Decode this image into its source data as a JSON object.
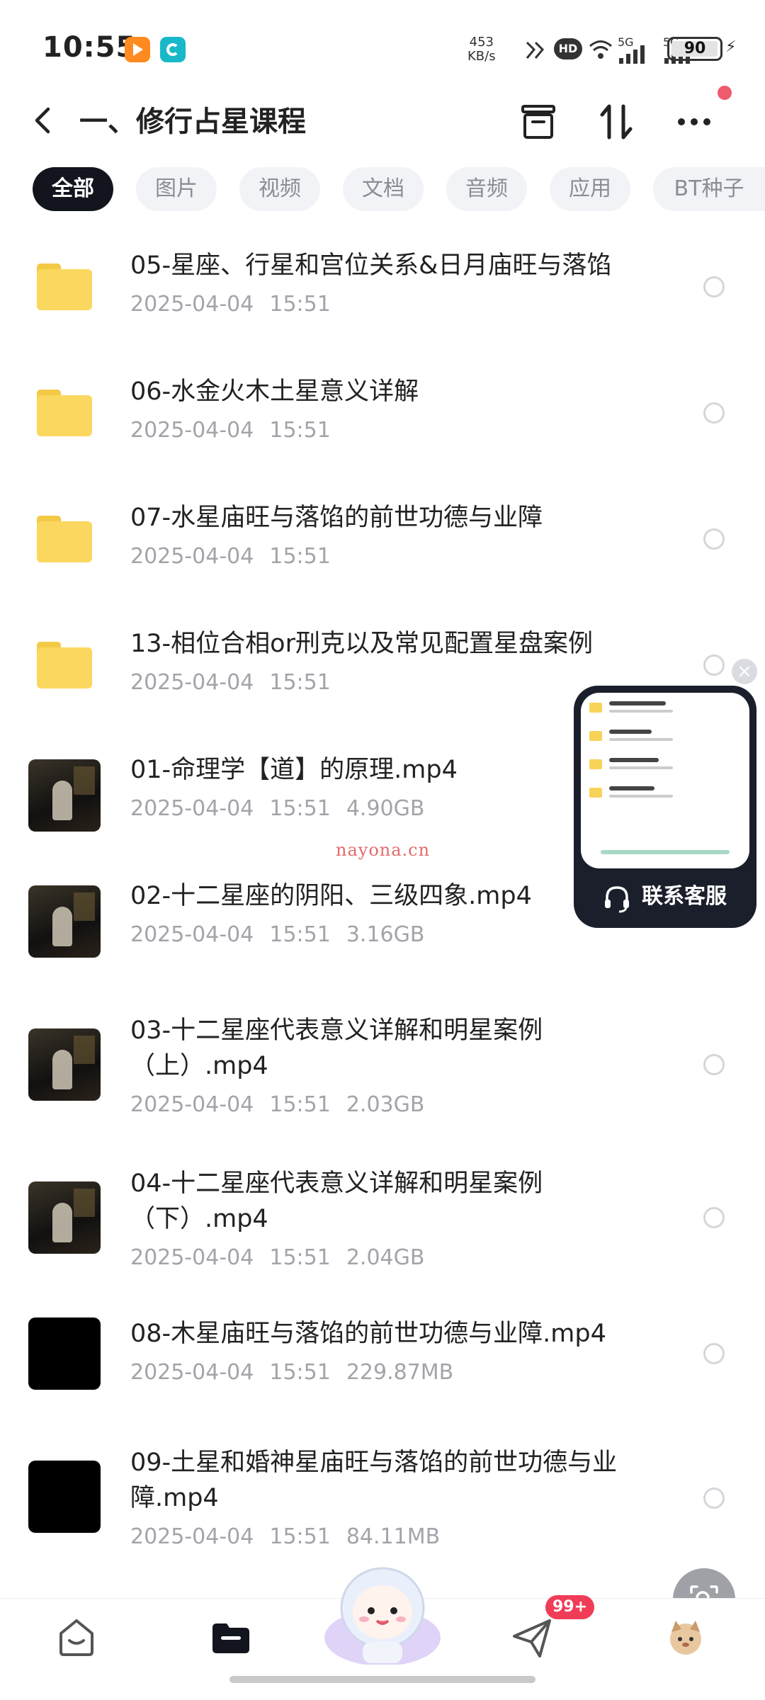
{
  "status_bar": {
    "time": "10:55",
    "net_speed_value": "453",
    "net_speed_unit": "KB/s",
    "network_1": "5G",
    "network_2": "5G",
    "battery": "90"
  },
  "header": {
    "title": "一、修行占星课程",
    "icons": [
      "back-icon",
      "archive-icon",
      "sort-icon",
      "more-icon"
    ]
  },
  "tabs": [
    "全部",
    "图片",
    "视频",
    "文档",
    "音频",
    "应用",
    "BT种子"
  ],
  "files": [
    {
      "name": "05-星座、行星和宫位关系&日月庙旺与落馅",
      "date": "2025-04-04",
      "time": "15:51",
      "size": "",
      "type": "folder"
    },
    {
      "name": "06-水金火木土星意义详解",
      "date": "2025-04-04",
      "time": "15:51",
      "size": "",
      "type": "folder"
    },
    {
      "name": "07-水星庙旺与落馅的前世功德与业障",
      "date": "2025-04-04",
      "time": "15:51",
      "size": "",
      "type": "folder"
    },
    {
      "name": "13-相位合相or刑克以及常见配置星盘案例",
      "date": "2025-04-04",
      "time": "15:51",
      "size": "",
      "type": "folder"
    },
    {
      "name": "01-命理学【道】的原理.mp4",
      "date": "2025-04-04",
      "time": "15:51",
      "size": "4.90GB",
      "type": "video"
    },
    {
      "name": "02-十二星座的阴阳、三级四象.mp4",
      "date": "2025-04-04",
      "time": "15:51",
      "size": "3.16GB",
      "type": "video"
    },
    {
      "name": "03-十二星座代表意义详解和明星案例（上）.mp4",
      "date": "2025-04-04",
      "time": "15:51",
      "size": "2.03GB",
      "type": "video"
    },
    {
      "name": "04-十二星座代表意义详解和明星案例（下）.mp4",
      "date": "2025-04-04",
      "time": "15:51",
      "size": "2.04GB",
      "type": "video"
    },
    {
      "name": "08-木星庙旺与落馅的前世功德与业障.mp4",
      "date": "2025-04-04",
      "time": "15:51",
      "size": "229.87MB",
      "type": "black"
    },
    {
      "name": "09-土星和婚神星庙旺与落馅的前世功德与业障.mp4",
      "date": "2025-04-04",
      "time": "15:51",
      "size": "84.11MB",
      "type": "black"
    }
  ],
  "customer_service": {
    "label": "联系客服",
    "close": "×"
  },
  "watermark": "nayona.cn",
  "bottom_nav": {
    "badge": "99+",
    "icons": [
      "home-icon",
      "folder-icon",
      "mascot-icon",
      "send-icon",
      "avatar"
    ]
  },
  "colors": {
    "active_tab_bg": "#12151d",
    "folder_yellow": "#fad75e",
    "badge_red": "#f03c57",
    "cs_card_bg": "#1b1f2b"
  }
}
